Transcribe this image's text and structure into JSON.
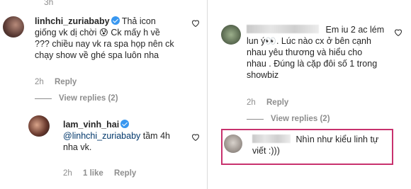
{
  "top_time": "3h",
  "left": {
    "comment1": {
      "username": "linhchi_zuriababy",
      "lines": [
        "Thả icon",
        "giống vk dị chời 😰 Ck mấy h về",
        "??? chiều nay vk ra spa họp nên ck",
        "chạy show về ghé spa luôn nha"
      ],
      "time": "2h",
      "reply": "Reply",
      "view_replies": "View replies (2)"
    },
    "comment2": {
      "username": "lam_vinh_hai",
      "mention": "@linhchi_zuriababy",
      "after_mention": " tầm 4h",
      "line2": "nha vk.",
      "time": "2h",
      "likes": "1 like",
      "reply": "Reply"
    }
  },
  "right": {
    "comment1": {
      "lines": [
        "Em iu 2 ac lém",
        "lun ý👀. Lúc nào cx ở bên cạnh",
        "nhau yêu thương và hiểu cho",
        "nhau . Đúng là cặp đôi số 1 trong",
        "showbiz"
      ],
      "time": "2h",
      "reply": "Reply",
      "view_replies": "View replies (2)"
    },
    "comment2": {
      "lines": [
        "Nhìn như kiểu linh tự",
        "viết :)))"
      ]
    }
  },
  "colors": {
    "highlight": "#c8326e",
    "verified": "#3897f0",
    "mention": "#00376b"
  }
}
